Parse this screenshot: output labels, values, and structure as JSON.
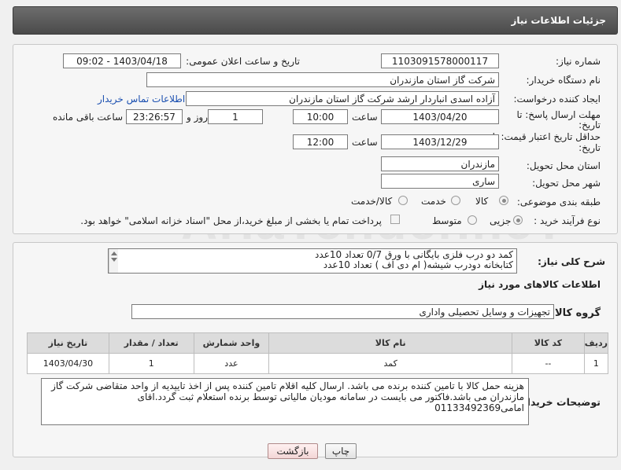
{
  "header": {
    "title": "جزئیات اطلاعات نیاز"
  },
  "labels": {
    "need_number": "شماره نیاز:",
    "announce_datetime": "تاریخ و ساعت اعلان عمومی:",
    "buyer_org": "نام دستگاه خریدار:",
    "requester": "ایجاد کننده درخواست:",
    "deadline_1": "مهلت ارسال پاسخ: تا",
    "deadline_2": "تاریخ:",
    "min_validity_1": "حداقل تاریخ اعتبار قیمت: تا",
    "min_validity_2": "تاریخ:",
    "time": "ساعت",
    "time2": "ساعت",
    "day_and": "روز و",
    "remaining": "ساعت باقی مانده",
    "province": "استان محل تحویل:",
    "city": "شهر محل تحویل:",
    "category": "طبقه بندی موضوعی:",
    "process": "نوع فرآیند خرید :",
    "description": "شرح کلی نیاز:",
    "items_info": "اطلاعات کالاهای مورد نیاز",
    "goods_group": "گروه کالا:",
    "buyer_notes": "توضیحات خریدار:"
  },
  "values": {
    "need_number": "1103091578000117",
    "announce_datetime": "1403/04/18 - 09:02",
    "buyer_org": "شرکت گاز استان مازندران",
    "requester": "آزاده اسدی انباردار ارشد شرکت گاز استان مازندران",
    "contact_link": "اطلاعات تماس خریدار",
    "deadline_date": "1403/04/20",
    "deadline_time": "10:00",
    "days": "1",
    "remaining_time": "23:26:57",
    "validity_date": "1403/12/29",
    "validity_time": "12:00",
    "province": "مازندران",
    "city": "ساری"
  },
  "category_options": [
    "کالا",
    "خدمت",
    "کالا/خدمت"
  ],
  "process_options": [
    "جزیی",
    "متوسط"
  ],
  "payment_note": "پرداخت تمام یا بخشی از مبلغ خرید،از محل \"اسناد خزانه اسلامی\" خواهد بود.",
  "description_lines": [
    "کمد دو درب فلزی بایگانی با ورق 0/7 تعداد 10عدد",
    "کتابخانه دودرب شیشه( ام دی اف ) تعداد 10عدد"
  ],
  "goods_group": "تجهیزات و وسایل تحصیلی واداری",
  "table": {
    "headers": [
      "ردیف",
      "کد کالا",
      "نام کالا",
      "واحد شمارش",
      "تعداد / مقدار",
      "تاریخ نیاز"
    ],
    "rows": [
      [
        "1",
        "--",
        "کمد",
        "عدد",
        "1",
        "1403/04/30"
      ]
    ]
  },
  "buyer_notes_text": "هزینه حمل کالا با تامین کننده برنده می باشد. ارسال کلیه اقلام تامین کننده پس از اخذ تاییدیه از واحد متقاضی شرکت گاز مازندران می باشد.فاکتور می بایست در سامانه مودیان مالیاتی توسط برنده استعلام ثبت گردد.اقای امامی01133492369",
  "buttons": {
    "print": "چاپ",
    "back": "بازگشت"
  },
  "watermark": "AriaTender.neT"
}
